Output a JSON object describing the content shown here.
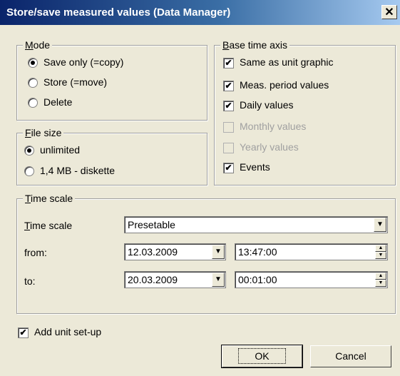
{
  "window": {
    "title": "Store/save measured values (Data Manager)",
    "close_glyph": "✕"
  },
  "mode": {
    "legend_u": "M",
    "legend_rest": "ode",
    "options": [
      {
        "label": "Save only (=copy)",
        "selected": true
      },
      {
        "label": "Store (=move)",
        "selected": false
      },
      {
        "label": "Delete",
        "selected": false
      }
    ]
  },
  "file_size": {
    "legend_u": "F",
    "legend_rest": "ile size",
    "options": [
      {
        "label": "unlimited",
        "selected": true
      },
      {
        "label": "1,4 MB - diskette",
        "selected": false
      }
    ]
  },
  "base_time_axis": {
    "legend_u": "B",
    "legend_rest": "ase time axis",
    "options": [
      {
        "label": "Same as unit graphic",
        "checked": true,
        "enabled": true
      },
      {
        "label": "Meas. period values",
        "checked": true,
        "enabled": true
      },
      {
        "label": "Daily values",
        "checked": true,
        "enabled": true
      },
      {
        "label": "Monthly values",
        "checked": false,
        "enabled": false
      },
      {
        "label": "Yearly values",
        "checked": false,
        "enabled": false
      },
      {
        "label": "Events",
        "checked": true,
        "enabled": true
      }
    ]
  },
  "time_scale": {
    "legend_u": "T",
    "legend_rest": "ime scale",
    "field_label_u": "T",
    "field_label_rest": "ime scale",
    "selected": "Presetable",
    "from_label": "from:",
    "from_date": "12.03.2009",
    "from_time": "13:47:00",
    "to_label": "to:",
    "to_date": "20.03.2009",
    "to_time": "00:01:00"
  },
  "add_unit_setup": {
    "label": "Add unit set-up",
    "checked": true
  },
  "buttons": {
    "ok": "OK",
    "cancel": "Cancel"
  },
  "glyphs": {
    "check": "✔",
    "dropdown": "▼",
    "spin_up": "▲",
    "spin_down": "▼"
  }
}
